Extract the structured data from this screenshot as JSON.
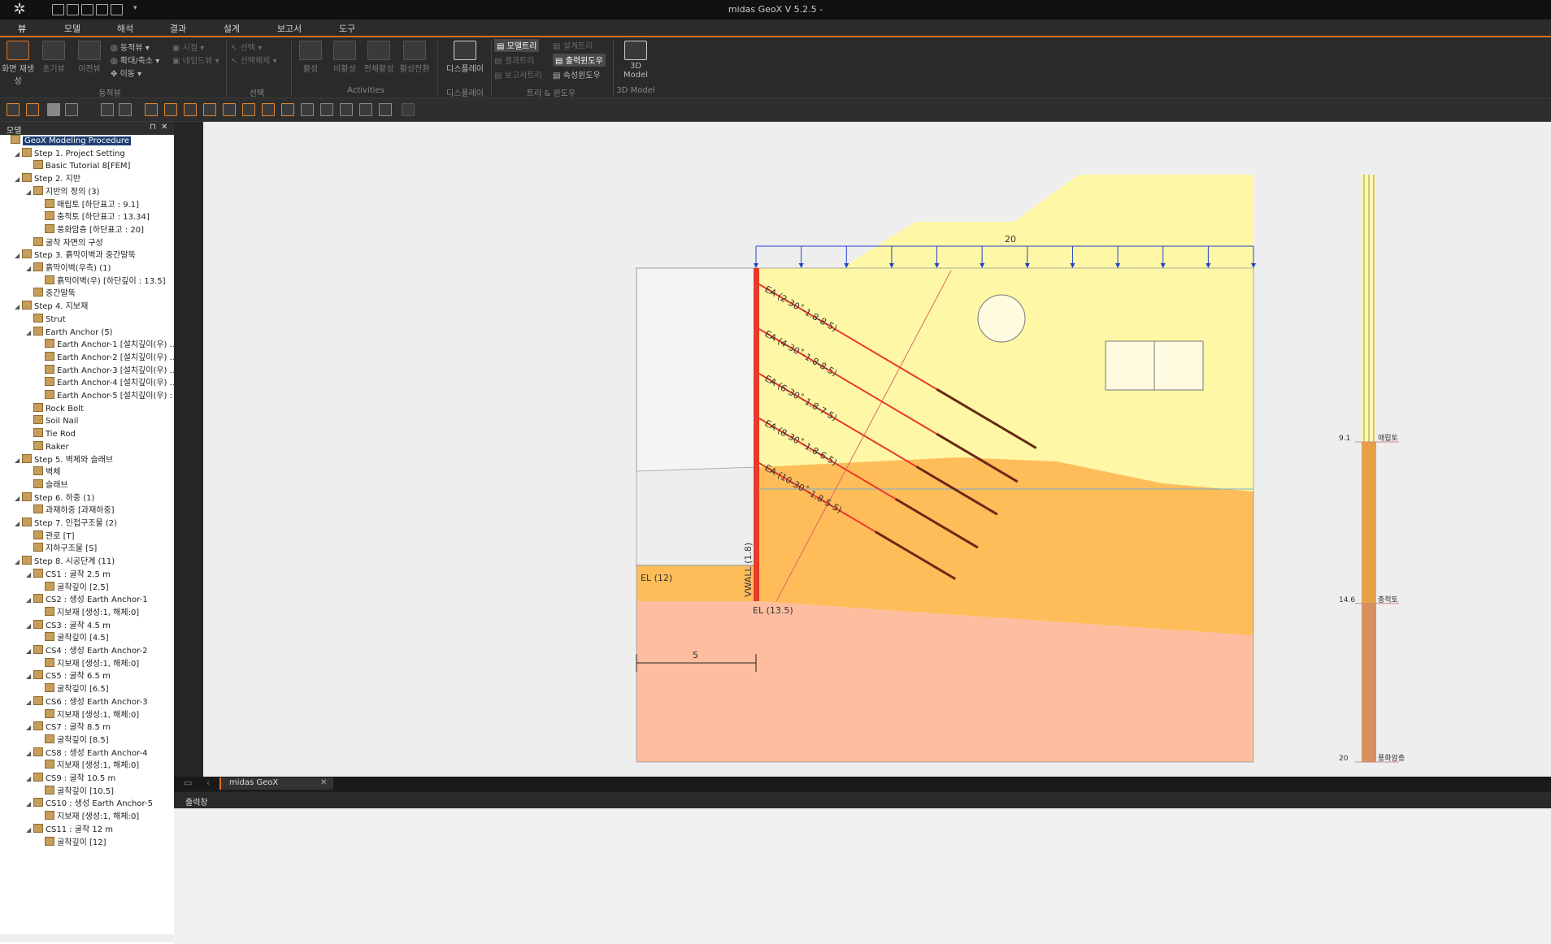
{
  "window_title": "midas GeoX V 5.2.5 -",
  "menu_tabs": [
    "뷰",
    "모델",
    "해석",
    "결과",
    "설계",
    "보고서",
    "도구"
  ],
  "ribbon": {
    "view_group": {
      "label": "동적뷰",
      "big1": "화면 재생성",
      "big2": "초기뷰",
      "big3": "이전뷰",
      "s1": "동적뷰",
      "s2": "확대/축소",
      "s3": "이동",
      "s4": "시점",
      "s5": "네임드뷰"
    },
    "select_group": {
      "label": "선택",
      "s1": "선택",
      "s2": "선택해제"
    },
    "activities_group": {
      "label": "Activities",
      "b1": "활성",
      "b2": "비활성",
      "b3": "전체활성",
      "b4": "활성전환"
    },
    "display_group": {
      "label": "디스플레이",
      "b1": "디스플레이"
    },
    "tree_group": {
      "label": "트리 & 윈도우",
      "s1": "모델트리",
      "s2": "결과트리",
      "s3": "보고서트리",
      "s4": "설계트리",
      "s5": "출력윈도우",
      "s6": "속성윈도우"
    },
    "model3d_group": {
      "label": "3D Model",
      "b1": "3D Model"
    }
  },
  "panel": {
    "title": "모델"
  },
  "tree": [
    {
      "t": "GeoX Modeling Procedure",
      "l": 0,
      "root": true
    },
    {
      "t": "Step 1. Project Setting",
      "l": 1,
      "tog": "◢"
    },
    {
      "t": "Basic Tutorial 8[FEM]",
      "l": 2
    },
    {
      "t": "Step 2. 지반",
      "l": 1,
      "tog": "◢"
    },
    {
      "t": "지반의 정의 (3)",
      "l": 2,
      "tog": "◢"
    },
    {
      "t": "매립토 [하단표고 : 9.1]",
      "l": 3
    },
    {
      "t": "충적토 [하단표고 : 13.34]",
      "l": 3
    },
    {
      "t": "풍화암층 [하단표고 : 20]",
      "l": 3
    },
    {
      "t": "굴착 자면의 구성",
      "l": 2
    },
    {
      "t": "Step 3. 흙막이벽과 중간말뚝",
      "l": 1,
      "tog": "◢"
    },
    {
      "t": "흙막이벽(우측) (1)",
      "l": 2,
      "tog": "◢"
    },
    {
      "t": "흙막이벽(우) [하단깊이 : 13.5]",
      "l": 3
    },
    {
      "t": "중간말뚝",
      "l": 2
    },
    {
      "t": "Step 4. 지보재",
      "l": 1,
      "tog": "◢"
    },
    {
      "t": "Strut",
      "l": 2
    },
    {
      "t": "Earth Anchor (5)",
      "l": 2,
      "tog": "◢"
    },
    {
      "t": "Earth Anchor-1 [설치깊이(우) ...",
      "l": 3
    },
    {
      "t": "Earth Anchor-2 [설치깊이(우) ...",
      "l": 3
    },
    {
      "t": "Earth Anchor-3 [설치깊이(우) ...",
      "l": 3
    },
    {
      "t": "Earth Anchor-4 [설치깊이(우) ...",
      "l": 3
    },
    {
      "t": "Earth Anchor-5 [설치깊이(우) :",
      "l": 3
    },
    {
      "t": "Rock Bolt",
      "l": 2
    },
    {
      "t": "Soil Nail",
      "l": 2
    },
    {
      "t": "Tie Rod",
      "l": 2
    },
    {
      "t": "Raker",
      "l": 2
    },
    {
      "t": "Step 5. 벽체와 슬래브",
      "l": 1,
      "tog": "◢"
    },
    {
      "t": "벽체",
      "l": 2
    },
    {
      "t": "슬래브",
      "l": 2
    },
    {
      "t": "Step 6. 하중 (1)",
      "l": 1,
      "tog": "◢"
    },
    {
      "t": "과재하중 [과재하중]",
      "l": 2
    },
    {
      "t": "Step 7. 인접구조물 (2)",
      "l": 1,
      "tog": "◢"
    },
    {
      "t": "관로 [T]",
      "l": 2
    },
    {
      "t": "지하구조물 [S]",
      "l": 2
    },
    {
      "t": "Step 8. 시공단계 (11)",
      "l": 1,
      "tog": "◢"
    },
    {
      "t": "CS1 : 굴착 2.5 m",
      "l": 2,
      "tog": "◢"
    },
    {
      "t": "굴착깊이 [2.5]",
      "l": 3
    },
    {
      "t": "CS2 : 생성 Earth Anchor-1",
      "l": 2,
      "tog": "◢"
    },
    {
      "t": "지보재 [생성:1, 해체:0]",
      "l": 3
    },
    {
      "t": "CS3 : 굴착 4.5 m",
      "l": 2,
      "tog": "◢"
    },
    {
      "t": "굴착깊이 [4.5]",
      "l": 3
    },
    {
      "t": "CS4 : 생성 Earth Anchor-2",
      "l": 2,
      "tog": "◢"
    },
    {
      "t": "지보재 [생성:1, 해체:0]",
      "l": 3
    },
    {
      "t": "CS5 : 굴착 6.5 m",
      "l": 2,
      "tog": "◢"
    },
    {
      "t": "굴착깊이 [6.5]",
      "l": 3
    },
    {
      "t": "CS6 : 생성 Earth Anchor-3",
      "l": 2,
      "tog": "◢"
    },
    {
      "t": "지보재 [생성:1, 해체:0]",
      "l": 3
    },
    {
      "t": "CS7 : 굴착 8.5 m",
      "l": 2,
      "tog": "◢"
    },
    {
      "t": "굴착깊이 [8.5]",
      "l": 3
    },
    {
      "t": "CS8 : 생성 Earth Anchor-4",
      "l": 2,
      "tog": "◢"
    },
    {
      "t": "지보재 [생성:1, 해체:0]",
      "l": 3
    },
    {
      "t": "CS9 : 굴착 10.5 m",
      "l": 2,
      "tog": "◢"
    },
    {
      "t": "굴착깊이 [10.5]",
      "l": 3
    },
    {
      "t": "CS10 : 생성 Earth Anchor-5",
      "l": 2,
      "tog": "◢"
    },
    {
      "t": "지보재 [생성:1, 해체:0]",
      "l": 3
    },
    {
      "t": "CS11 : 굴착 12 m",
      "l": 2,
      "tog": "◢"
    },
    {
      "t": "굴착깊이 [12]",
      "l": 3
    }
  ],
  "drawing": {
    "load_value": "20",
    "anchors": [
      "EA (2-30˚-1.8-8-5)",
      "EA (4-30˚-1.8-8-5)",
      "EA (6-30˚-1.8-7-5)",
      "EA (8-30˚-1.8-6-5)",
      "EA (10-30˚-1.8-5-5)"
    ],
    "wall_label": "VWALL (1.8)",
    "el_left": "EL (12)",
    "el_bottom": "EL (13.5)",
    "dim_value": "5",
    "bore": [
      {
        "depth": "9.1",
        "name": "매립토"
      },
      {
        "depth": "14.6",
        "name": "충적토"
      },
      {
        "depth": "20",
        "name": "풍화암층"
      }
    ],
    "colors": {
      "fill_top": "#fef8a6",
      "fill_mid": "#ffbd5a",
      "fill_bot": "#fdbd9e",
      "wall": "#e8392a",
      "anchor_free": "#e8392a",
      "anchor_bond": "#6a2a14",
      "load": "#2244cc"
    }
  },
  "doc_tab": "midas GeoX",
  "output_title": "출력창"
}
